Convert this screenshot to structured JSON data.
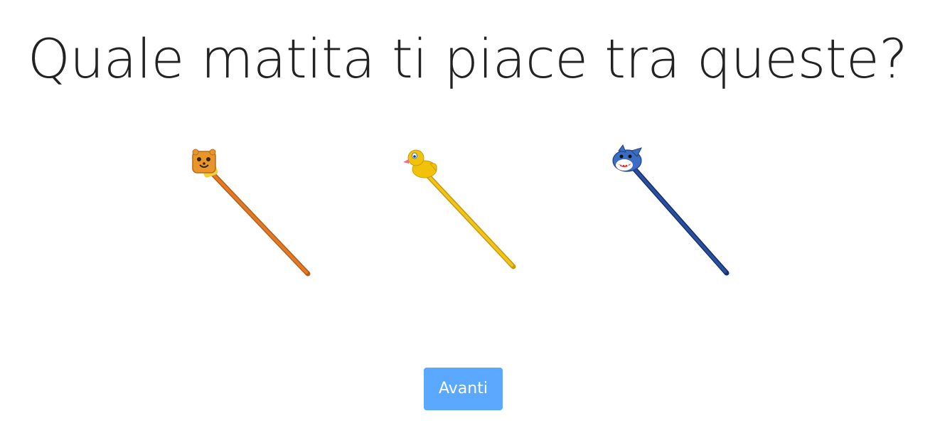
{
  "question": {
    "title": "Quale matita ti piace tra queste?"
  },
  "options": [
    {
      "icon": "bear-pencil-icon",
      "pencil_color": "#d96f1f",
      "topper_color": "#e8962b"
    },
    {
      "icon": "duck-pencil-icon",
      "pencil_color": "#f0c419",
      "topper_color": "#f2c20a"
    },
    {
      "icon": "shark-pencil-icon",
      "pencil_color": "#1f3f8a",
      "topper_color": "#3d6cc4"
    }
  ],
  "actions": {
    "next_label": "Avanti"
  },
  "colors": {
    "button_bg": "#5aa8ff",
    "title_text": "#222222"
  }
}
